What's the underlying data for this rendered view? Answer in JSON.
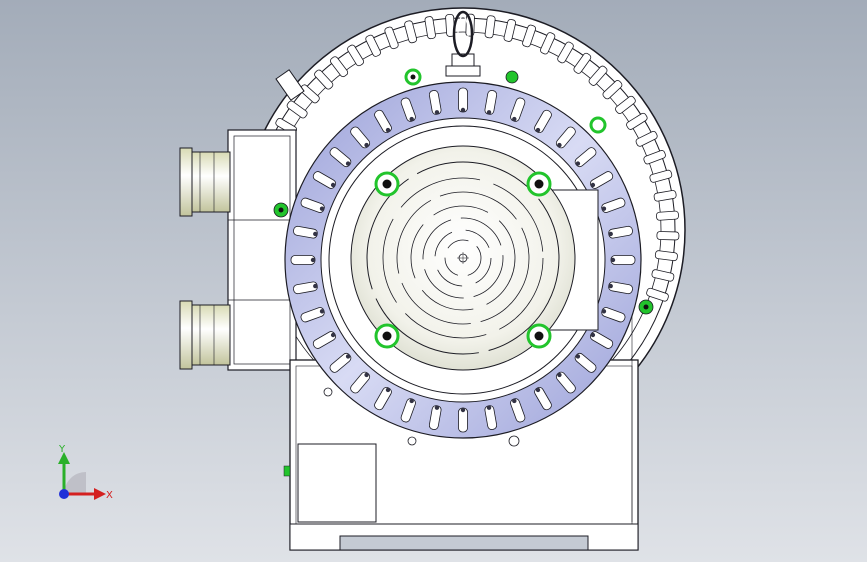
{
  "viewport": {
    "background_top": "#a3acb9",
    "background_bottom": "#dfe2e7",
    "line_color": "#1c1c24",
    "body_fill": "#ffffff",
    "ring_fill": "#b8bde6",
    "accent_green": "#22c42c",
    "bolt_fill": "#111111"
  },
  "triad": {
    "x_label": "X",
    "y_label": "Y",
    "x_color": "#d42020",
    "y_color": "#2ab02a",
    "z_color": "#2030d8"
  },
  "icons": {
    "triad": "view-orientation-triad-icon",
    "bolts": "mounting-bolt-icon",
    "eyebolt": "lifting-eyebolt-icon"
  }
}
